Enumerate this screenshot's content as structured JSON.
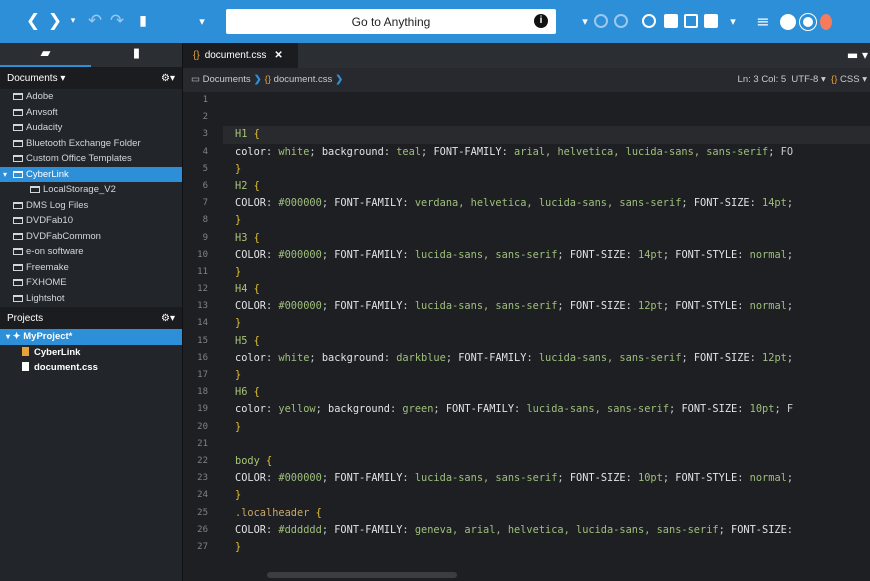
{
  "toolbar": {
    "search_placeholder": "Go to Anything",
    "info_glyph": "i"
  },
  "sidebar": {
    "documents_label": "Documents",
    "documents_items": [
      "Adobe",
      "Anvsoft",
      "Audacity",
      "Bluetooth Exchange Folder",
      "Custom Office Templates",
      "CyberLink",
      "LocalStorage_V2",
      "DMS Log Files",
      "DVDFab10",
      "DVDFabCommon",
      "e-on software",
      "Freemake",
      "FXHOME",
      "Lightshot"
    ],
    "selected_item": "CyberLink",
    "child_item": "LocalStorage_V2",
    "projects_label": "Projects",
    "project_name": "MyProject*",
    "project_items": [
      "CyberLink",
      "document.css"
    ]
  },
  "editor": {
    "tab_label": "document.css",
    "tab_close": "✕",
    "tab_brace": "{}",
    "breadcrumb_root": "Documents",
    "breadcrumb_file": "document.css",
    "status_pos": "Ln: 3 Col: 5",
    "status_enc": "UTF-8",
    "status_lang": "CSS",
    "line_numbers": [
      "1",
      "2",
      "3",
      "4",
      "5",
      "6",
      "7",
      "8",
      "9",
      "10",
      "11",
      "12",
      "13",
      "14",
      "15",
      "16",
      "17",
      "18",
      "19",
      "20",
      "21",
      "22",
      "23",
      "24",
      "25",
      "26",
      "27"
    ],
    "code_lines": [
      "",
      "",
      "H1 {",
      "color: white; background: teal; FONT-FAMILY: arial, helvetica, lucida-sans, sans-serif; FO",
      "}",
      "H2 {",
      "COLOR: #000000; FONT-FAMILY: verdana, helvetica, lucida-sans, sans-serif; FONT-SIZE: 14pt;",
      "}",
      "H3 {",
      "COLOR: #000000; FONT-FAMILY: lucida-sans, sans-serif; FONT-SIZE: 14pt; FONT-STYLE: normal;",
      "}",
      "H4 {",
      "COLOR: #000000; FONT-FAMILY: lucida-sans, sans-serif; FONT-SIZE: 12pt; FONT-STYLE: normal;",
      "}",
      "H5 {",
      "color: white; background: darkblue; FONT-FAMILY: lucida-sans, sans-serif; FONT-SIZE: 12pt;",
      "}",
      "H6 {",
      "color: yellow; background: green; FONT-FAMILY: lucida-sans, sans-serif; FONT-SIZE: 10pt; F",
      "}",
      "",
      "body {",
      "COLOR: #000000; FONT-FAMILY: lucida-sans, sans-serif; FONT-SIZE: 10pt; FONT-STYLE: normal;",
      "}",
      ".localheader {",
      "COLOR: #dddddd; FONT-FAMILY: geneva, arial, helvetica, lucida-sans, sans-serif; FONT-SIZE:",
      "}"
    ]
  },
  "colors": {
    "accent": "#2d8fd8",
    "toolbar_yellow": "#f5c518",
    "toolbar_blue": "#2d8fd8",
    "toolbar_red": "#e74c3c"
  }
}
